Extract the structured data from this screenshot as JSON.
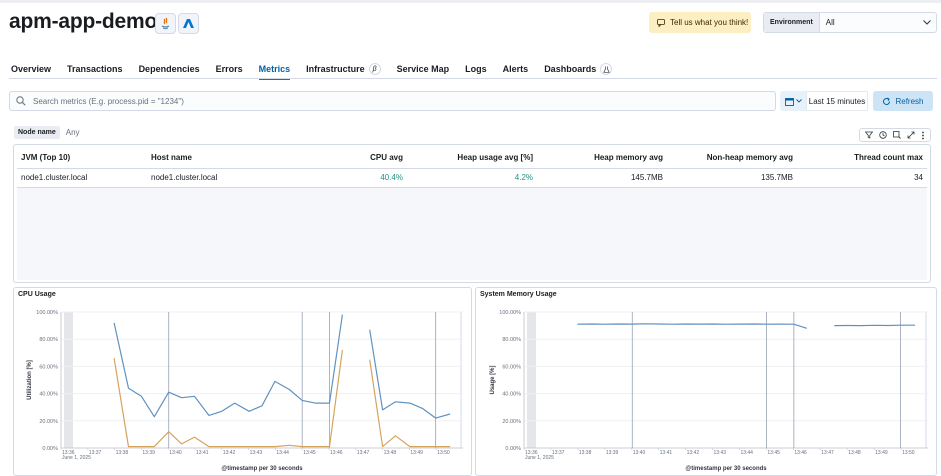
{
  "header": {
    "title": "apm-app-demo",
    "feedback_label": "Tell us what you think!",
    "environment_label": "Environment",
    "environment_value": "All"
  },
  "tabs": [
    {
      "label": "Overview",
      "active": false
    },
    {
      "label": "Transactions",
      "active": false
    },
    {
      "label": "Dependencies",
      "active": false
    },
    {
      "label": "Errors",
      "active": false
    },
    {
      "label": "Metrics",
      "active": true
    },
    {
      "label": "Infrastructure",
      "active": false,
      "badge": "β"
    },
    {
      "label": "Service Map",
      "active": false
    },
    {
      "label": "Logs",
      "active": false
    },
    {
      "label": "Alerts",
      "active": false
    },
    {
      "label": "Dashboards",
      "active": false,
      "badge": "flask"
    }
  ],
  "search": {
    "placeholder": "Search metrics (E.g. process.pid = \"1234\")"
  },
  "date_picker": {
    "label": "Last 15 minutes"
  },
  "refresh": {
    "label": "Refresh"
  },
  "filter": {
    "label": "Node name",
    "value": "Any"
  },
  "table": {
    "columns": [
      "JVM (Top 10)",
      "Host name",
      "CPU avg",
      "Heap usage avg [%]",
      "Heap memory avg",
      "Non-heap memory avg",
      "Thread count max"
    ],
    "rows": [
      [
        "node1.cluster.local",
        "node1.cluster.local",
        "40.4%",
        "4.2%",
        "145.7MB",
        "135.7MB",
        "34"
      ]
    ]
  },
  "colors": {
    "accent": "#0077cc",
    "series_blue": "#6092c0",
    "series_orange": "#d6a35c",
    "good": "#209280"
  },
  "chart_data": [
    {
      "type": "line",
      "title": "CPU Usage",
      "ylabel": "Utilization [%]",
      "xlabel": "@timestamp per 30 seconds",
      "ylim": [
        0,
        100
      ],
      "yticks": [
        "0.00%",
        "20.00%",
        "40.00%",
        "60.00%",
        "80.00%",
        "100.00%"
      ],
      "xticks": [
        "13:36",
        "13:37",
        "13:38",
        "13:39",
        "13:40",
        "13:41",
        "13:42",
        "13:43",
        "13:44",
        "13:45",
        "13:46",
        "13:47",
        "13:48",
        "13:49",
        "13:50"
      ],
      "date_label": "June 1, 2025",
      "series": [
        {
          "color": "#6092c0",
          "points": [
            [
              13.633,
              92
            ],
            [
              13.642,
              44
            ],
            [
              13.65,
              38
            ],
            [
              13.658,
              23
            ],
            [
              13.667,
              41
            ],
            [
              13.675,
              37
            ],
            [
              13.683,
              38
            ],
            [
              13.692,
              24
            ],
            [
              13.7,
              27
            ],
            [
              13.708,
              33
            ],
            [
              13.717,
              27
            ],
            [
              13.725,
              31
            ],
            [
              13.733,
              49
            ],
            [
              13.742,
              43
            ],
            [
              13.75,
              35
            ],
            [
              13.758,
              33
            ],
            [
              13.767,
              33
            ],
            [
              13.775,
              98
            ],
            null,
            [
              13.792,
              87
            ],
            [
              13.8,
              28
            ],
            [
              13.808,
              34
            ],
            [
              13.817,
              33
            ],
            [
              13.825,
              29
            ],
            [
              13.833,
              22
            ],
            [
              13.842,
              25
            ]
          ]
        },
        {
          "color": "#d6a35c",
          "points": [
            [
              13.633,
              66
            ],
            [
              13.642,
              1
            ],
            [
              13.65,
              1
            ],
            [
              13.658,
              1
            ],
            [
              13.667,
              12
            ],
            [
              13.675,
              3
            ],
            [
              13.683,
              8
            ],
            [
              13.692,
              1
            ],
            [
              13.7,
              1
            ],
            [
              13.708,
              1
            ],
            [
              13.717,
              1
            ],
            [
              13.725,
              1
            ],
            [
              13.733,
              1
            ],
            [
              13.742,
              2
            ],
            [
              13.75,
              1
            ],
            [
              13.758,
              1
            ],
            [
              13.767,
              1
            ],
            [
              13.775,
              72
            ],
            null,
            [
              13.792,
              65
            ],
            [
              13.8,
              1
            ],
            [
              13.808,
              9
            ],
            [
              13.817,
              1
            ],
            [
              13.825,
              1
            ],
            [
              13.833,
              1
            ],
            [
              13.842,
              1
            ]
          ]
        }
      ]
    },
    {
      "type": "line",
      "title": "System Memory Usage",
      "ylabel": "Usage [%]",
      "xlabel": "@timestamp per 30 seconds",
      "ylim": [
        0,
        100
      ],
      "yticks": [
        "0.00%",
        "20.00%",
        "40.00%",
        "60.00%",
        "80.00%",
        "100.00%"
      ],
      "xticks": [
        "13:36",
        "13:37",
        "13:38",
        "13:39",
        "13:40",
        "13:41",
        "13:42",
        "13:43",
        "13:44",
        "13:45",
        "13:46",
        "13:47",
        "13:48",
        "13:49",
        "13:50"
      ],
      "date_label": "June 1, 2025",
      "series": [
        {
          "color": "#6092c0",
          "points": [
            [
              13.633,
              91
            ],
            [
              13.642,
              91.2
            ],
            [
              13.65,
              91
            ],
            [
              13.658,
              91.2
            ],
            [
              13.667,
              91.1
            ],
            [
              13.675,
              91.3
            ],
            [
              13.683,
              91.2
            ],
            [
              13.692,
              91
            ],
            [
              13.7,
              91.2
            ],
            [
              13.708,
              91.1
            ],
            [
              13.717,
              91.2
            ],
            [
              13.725,
              91
            ],
            [
              13.733,
              91.1
            ],
            [
              13.742,
              91.2
            ],
            [
              13.75,
              91
            ],
            [
              13.758,
              91.1
            ],
            [
              13.767,
              91
            ],
            [
              13.775,
              88
            ],
            null,
            [
              13.792,
              90
            ],
            [
              13.8,
              90.1
            ],
            [
              13.808,
              90
            ],
            [
              13.817,
              90.2
            ],
            [
              13.825,
              90.1
            ],
            [
              13.833,
              90.3
            ],
            [
              13.842,
              90.3
            ]
          ]
        }
      ]
    }
  ]
}
